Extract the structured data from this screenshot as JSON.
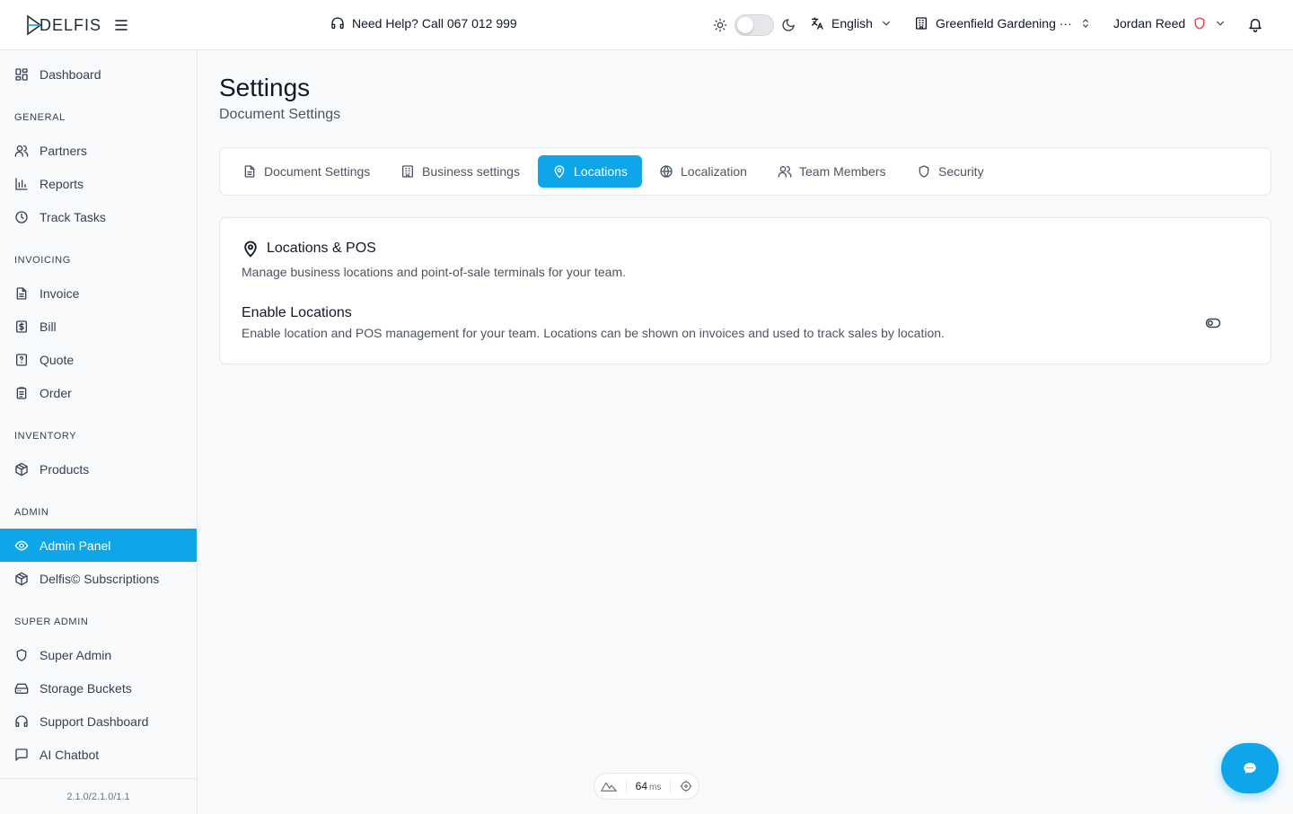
{
  "header": {
    "brand": "DELFIS",
    "help_text": "Need Help? Call 067 012 999",
    "language": "English",
    "company": "Greenfield Gardening ···",
    "user_name": "Jordan Reed"
  },
  "sidebar": {
    "dashboard": "Dashboard",
    "sections": {
      "general": "GENERAL",
      "invoicing": "INVOICING",
      "inventory": "INVENTORY",
      "admin": "ADMIN",
      "super_admin": "SUPER ADMIN"
    },
    "items": {
      "partners": "Partners",
      "reports": "Reports",
      "track_tasks": "Track Tasks",
      "invoice": "Invoice",
      "bill": "Bill",
      "quote": "Quote",
      "order": "Order",
      "products": "Products",
      "admin_panel": "Admin Panel",
      "subscriptions": "Delfis© Subscriptions",
      "super_admin": "Super Admin",
      "storage_buckets": "Storage Buckets",
      "support_dashboard": "Support Dashboard",
      "ai_chatbot": "AI Chatbot"
    },
    "active_item": "Admin Panel",
    "version": "2.1.0/2.1.0/1.1"
  },
  "page": {
    "title": "Settings",
    "subtitle": "Document Settings"
  },
  "tabs": {
    "document_settings": "Document Settings",
    "business_settings": "Business settings",
    "locations": "Locations",
    "localization": "Localization",
    "team_members": "Team Members",
    "security": "Security",
    "active": "Locations"
  },
  "card": {
    "title": "Locations & POS",
    "description": "Manage business locations and point-of-sale terminals for your team.",
    "option_title": "Enable Locations",
    "option_description": "Enable location and POS management for your team. Locations can be shown on invoices and used to track sales by location."
  },
  "perf": {
    "value": "64",
    "unit": "ms"
  },
  "colors": {
    "accent": "#0ea5e9",
    "border": "#e5e7eb",
    "user_badge": "#ef4444"
  }
}
